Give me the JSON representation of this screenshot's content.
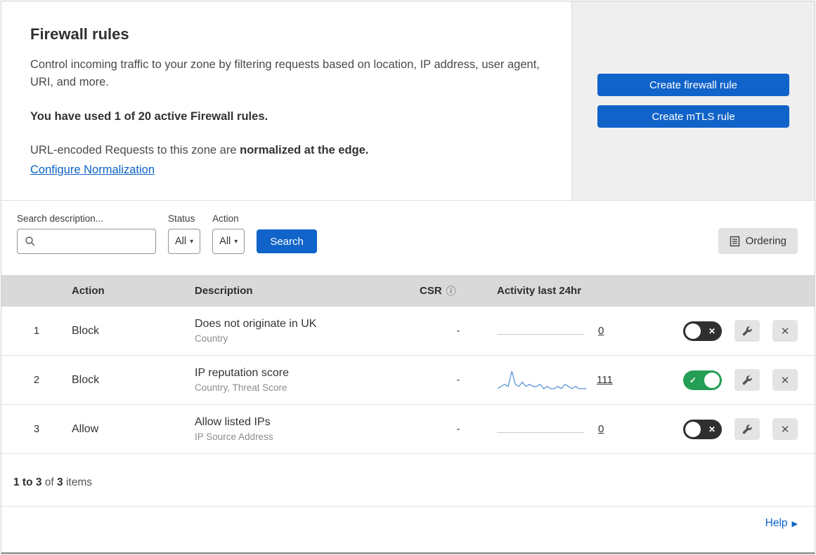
{
  "intro": {
    "title": "Firewall rules",
    "description": "Control incoming traffic to your zone by filtering requests based on location, IP address, user agent, URI, and more.",
    "usage_note": "You have used 1 of 20 active Firewall rules.",
    "normalization_text": "URL-encoded Requests to this zone are",
    "normalization_bold": "normalized at the edge.",
    "normalization_link": "Configure Normalization"
  },
  "actions_panel": {
    "create_firewall_rule": "Create firewall rule",
    "create_mtls_rule": "Create mTLS rule"
  },
  "filters": {
    "search_label": "Search description...",
    "status": {
      "label": "Status",
      "value": "All"
    },
    "action": {
      "label": "Action",
      "value": "All"
    },
    "search_button": "Search",
    "ordering_button": "Ordering"
  },
  "table": {
    "headers": {
      "action": "Action",
      "description": "Description",
      "csr": "CSR",
      "activity": "Activity last 24hr"
    },
    "rows": [
      {
        "priority": "1",
        "action": "Block",
        "description": "Does not originate in UK",
        "criteria": "Country",
        "csr": "-",
        "activity": "0",
        "enabled": false
      },
      {
        "priority": "2",
        "action": "Block",
        "description": "IP reputation score",
        "criteria": "Country, Threat Score",
        "csr": "-",
        "activity": "111",
        "enabled": true,
        "sparkline": [
          1,
          2,
          3,
          2,
          9,
          3,
          2,
          4,
          2,
          3,
          2,
          2,
          3,
          1,
          2,
          1,
          1,
          2,
          1,
          3,
          2,
          1,
          2,
          1,
          1,
          1
        ]
      },
      {
        "priority": "3",
        "action": "Allow",
        "description": "Allow listed IPs",
        "criteria": "IP Source Address",
        "csr": "-",
        "activity": "0",
        "enabled": false
      }
    ]
  },
  "footer": {
    "range": "1 to 3",
    "of_text": "of",
    "total": "3",
    "items_text": "items",
    "help": "Help"
  },
  "icons": {
    "info": "ⓘ",
    "caret": "▾",
    "help_arrow": "▶",
    "close": "✕",
    "check": "✓"
  },
  "colors": {
    "primary_blue": "#1063c9",
    "link_blue": "#0b62c6",
    "toggle_on_green": "#239e54",
    "toggle_off_dark": "#2f2f2f",
    "sparkline_blue": "#6f9fd8",
    "table_header_gray": "#d9d9d9",
    "panel_gray": "#efefef"
  }
}
